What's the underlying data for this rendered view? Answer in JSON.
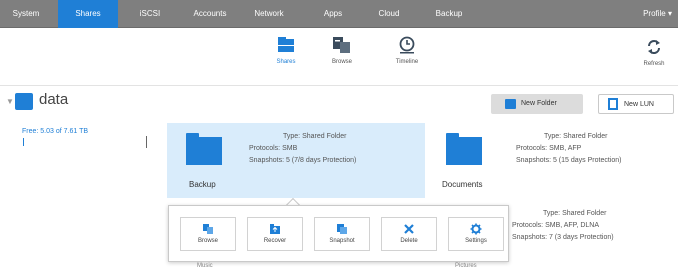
{
  "topnav": {
    "tabs": [
      {
        "label": "System",
        "active": false
      },
      {
        "label": "Shares",
        "active": true
      },
      {
        "label": "iSCSI",
        "active": false
      },
      {
        "label": "Accounts",
        "active": false
      },
      {
        "label": "Network",
        "active": false
      },
      {
        "label": "Apps",
        "active": false
      },
      {
        "label": "Cloud",
        "active": false
      },
      {
        "label": "Backup",
        "active": false
      }
    ],
    "profile": "Profile ▾"
  },
  "subtoolbar": {
    "items": [
      {
        "label": "Shares",
        "icon": "folder-stack-icon",
        "active": true
      },
      {
        "label": "Browse",
        "icon": "browse-icon",
        "active": false
      },
      {
        "label": "Timeline",
        "icon": "timeline-clock-icon",
        "active": false
      }
    ],
    "refresh_label": "Refresh"
  },
  "volume": {
    "name": "data"
  },
  "buttons": {
    "new_folder": "New Folder",
    "new_lun": "New LUN"
  },
  "left_pane": {
    "used": "Free: 5.03 of 7.61 TB"
  },
  "shares": [
    {
      "name": "Backup",
      "type": "Type: Shared Folder",
      "protocols": "Protocols: SMB",
      "snapshots": "Snapshots: 5 (7/8 days Protection)",
      "selected": true
    },
    {
      "name": "Documents",
      "type": "Type: Shared Folder",
      "protocols": "Protocols: SMB, AFP",
      "snapshots": "Snapshots: 5 (15 days Protection)",
      "selected": false
    },
    {
      "name": "",
      "type": "Type: Shared Folder",
      "protocols": "Protocols: SMB, AFP, DLNA",
      "snapshots": "Snapshots: 7 (3 days Protection)",
      "selected": false
    }
  ],
  "popup": {
    "buttons": [
      {
        "label": "Browse",
        "icon": "browse-icon"
      },
      {
        "label": "Recover",
        "icon": "recover-icon"
      },
      {
        "label": "Snapshot",
        "icon": "snapshot-icon"
      },
      {
        "label": "Delete",
        "icon": "delete-x-icon"
      },
      {
        "label": "Settings",
        "icon": "gear-icon"
      }
    ]
  },
  "peek": {
    "left": "Music",
    "right": "Pictures"
  },
  "colors": {
    "accent": "#1f7fd6",
    "nav_bg": "#7f7f7f",
    "selected_card_bg": "#d9ecfb"
  }
}
